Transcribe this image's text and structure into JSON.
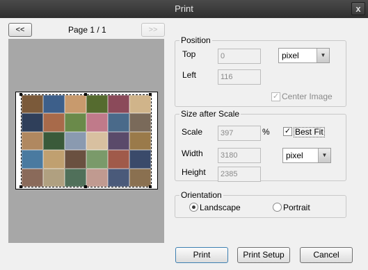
{
  "window": {
    "title": "Print",
    "close_glyph": "x"
  },
  "pager": {
    "prev_label": "<<",
    "next_label": ">>",
    "page_text": "Page 1 / 1"
  },
  "position": {
    "group_title": "Position",
    "top_label": "Top",
    "top_value": "0",
    "left_label": "Left",
    "left_value": "116",
    "unit_value": "pixel",
    "center_label": "Center Image",
    "center_checked": true
  },
  "scale": {
    "group_title": "Size after Scale",
    "scale_label": "Scale",
    "scale_value": "397",
    "percent": "%",
    "best_fit_label": "Best Fit",
    "best_fit_checked": true,
    "width_label": "Width",
    "width_value": "3180",
    "height_label": "Height",
    "height_value": "2385",
    "unit_value": "pixel"
  },
  "orientation": {
    "group_title": "Orientation",
    "landscape_label": "Landscape",
    "portrait_label": "Portrait",
    "selected": "Landscape"
  },
  "buttons": {
    "print": "Print",
    "print_setup": "Print Setup",
    "cancel": "Cancel"
  },
  "icons": {
    "check": "✓",
    "dropdown": "chevron-down-icon",
    "close": "close-icon"
  },
  "tile_colors": [
    "#7b5a3a",
    "#3d5f8a",
    "#c89a6d",
    "#556b2f",
    "#8b4a5a",
    "#d0b48a",
    "#2f3f5a",
    "#a86a4a",
    "#6a8a4a",
    "#c07a8a",
    "#4a6a8a",
    "#7a6a5a",
    "#b08860",
    "#3a5a3a",
    "#8a9ab0",
    "#d8c0a0",
    "#5a4a6a",
    "#9a7a4a",
    "#4a7aa0",
    "#c0a070",
    "#6a5040",
    "#7a9a6a",
    "#a05a4a",
    "#3a4a6a",
    "#8a6a5a",
    "#b0a080",
    "#50705a",
    "#c09a90",
    "#4a5a7a",
    "#8a7050"
  ]
}
